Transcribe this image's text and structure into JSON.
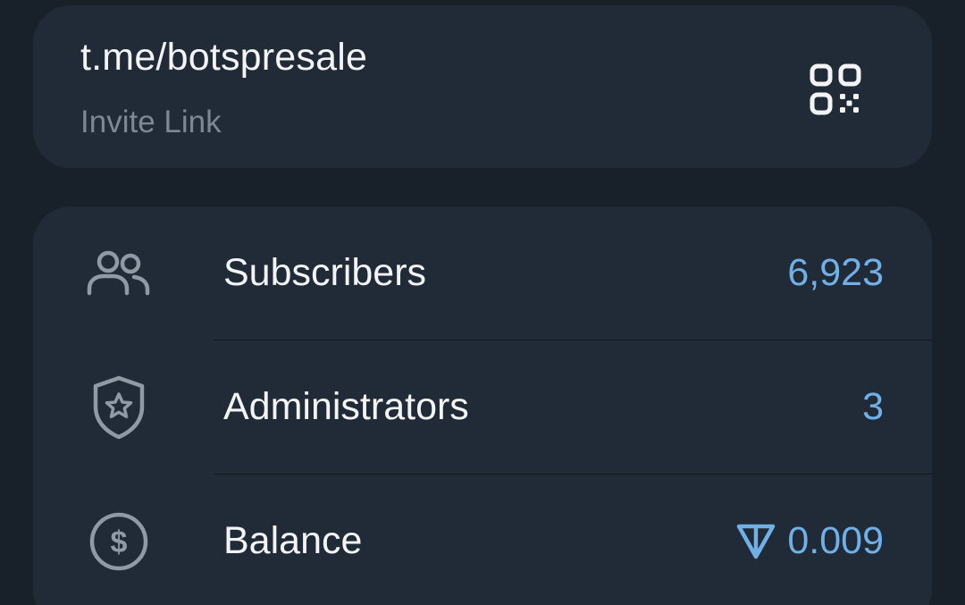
{
  "invite": {
    "link": "t.me/botspresale",
    "label": "Invite Link",
    "qr_icon": "qr-code-icon"
  },
  "stats": [
    {
      "icon": "users-icon",
      "label": "Subscribers",
      "value": "6,923"
    },
    {
      "icon": "shield-star-icon",
      "label": "Administrators",
      "value": "3"
    },
    {
      "icon": "dollar-circle-icon",
      "label": "Balance",
      "value": "0.009",
      "currency_icon": "ton-icon"
    }
  ],
  "colors": {
    "background": "#18202a",
    "card": "#212b37",
    "text_primary": "#f2f4f6",
    "text_secondary": "#7d8894",
    "accent": "#6fb0e6",
    "icon": "#8f9aa5"
  }
}
